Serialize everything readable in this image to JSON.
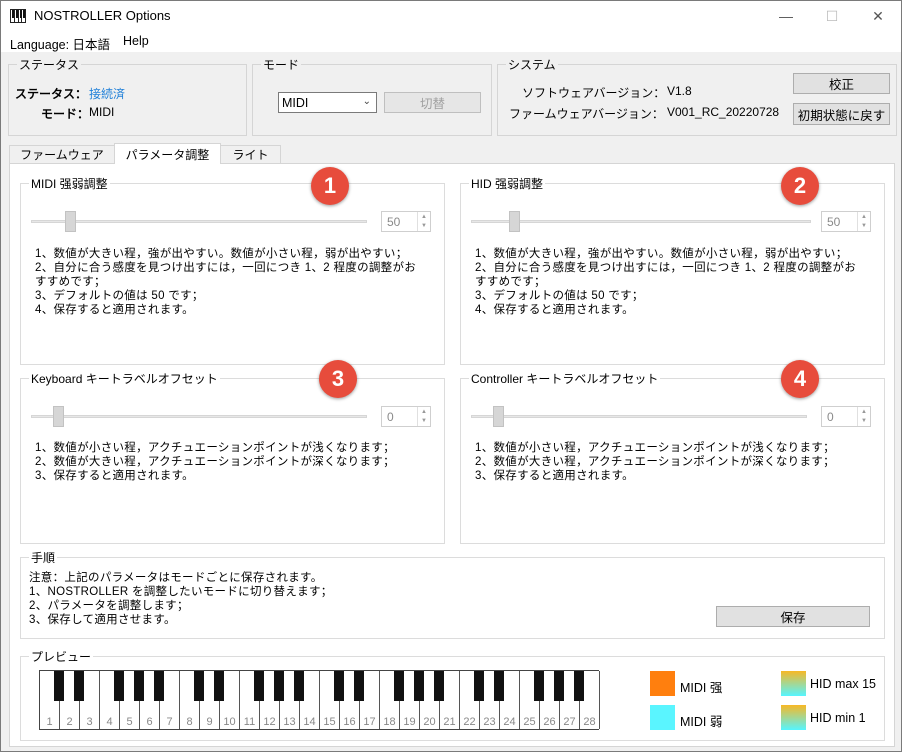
{
  "window": {
    "title": "NOSTROLLER  Options",
    "minimize": "—",
    "maximize": "☐",
    "close": "✕"
  },
  "menu": {
    "language": "Language: 日本語",
    "help": "Help"
  },
  "status": {
    "title": "ステータス",
    "status_label": "ステータス：",
    "status_value": "接続済",
    "status_color": "#1e7fd8",
    "mode_label": "モード：",
    "mode_value": "MIDI"
  },
  "mode": {
    "title": "モード",
    "select_value": "MIDI",
    "switch_label": "切替"
  },
  "system": {
    "title": "システム",
    "software_label": "ソフトウェアバージョン：",
    "software_value": "V1.8",
    "firmware_label": "ファームウェアバージョン：",
    "firmware_value": "V001_RC_20220728",
    "calibrate_label": "校正",
    "reset_label": "初期状態に戻す"
  },
  "tabs": [
    "ファームウェア",
    "パラメータ調整",
    "ライト"
  ],
  "active_tab": "パラメータ調整",
  "panels": [
    {
      "badge": "1",
      "title": "MIDI 强弱調整",
      "value": "50",
      "lines": [
        "1、数値が大きい程，強が出やすい。数値が小さい程，弱が出やすい；",
        "2、自分に合う感度を見つけ出すには，一回につき 1、2 程度の調整がお",
        "すすめです；",
        "3、デフォルトの値は 50 です；",
        "4、保存すると適用されます。"
      ]
    },
    {
      "badge": "2",
      "title": "HID 强弱調整",
      "value": "50",
      "lines": [
        "1、数値が大きい程，強が出やすい。数値が小さい程，弱が出やすい；",
        "2、自分に合う感度を見つけ出すには，一回につき 1、2 程度の調整がお",
        "すすめです；",
        "3、デフォルトの値は 50 です；",
        "4、保存すると適用されます。"
      ]
    },
    {
      "badge": "3",
      "title": "Keyboard キートラベルオフセット",
      "value": "0",
      "lines": [
        "1、数値が小さい程，アクチュエーションポイントが浅くなります；",
        "2、数値が大きい程，アクチュエーションポイントが深くなります；",
        "3、保存すると適用されます。"
      ]
    },
    {
      "badge": "4",
      "title": "Controller キートラベルオフセット",
      "value": "0",
      "lines": [
        "1、数値が小さい程，アクチュエーションポイントが浅くなります；",
        "2、数値が大きい程，アクチュエーションポイントが深くなります；",
        "3、保存すると適用されます。"
      ]
    }
  ],
  "procedure": {
    "title": "手順",
    "lines": [
      "注意：上記のパラメータはモードごとに保存されます。",
      "1、NOSTROLLER を調整したいモードに切り替えます；",
      "2、パラメータを調整します；",
      "3、保存して適用させます。"
    ],
    "save_label": "保存"
  },
  "preview": {
    "title": "プレビュー",
    "keys": [
      "1",
      "2",
      "3",
      "4",
      "5",
      "6",
      "7",
      "8",
      "9",
      "10",
      "11",
      "12",
      "13",
      "14",
      "15",
      "16",
      "17",
      "18",
      "19",
      "20",
      "21",
      "22",
      "23",
      "24",
      "25",
      "26",
      "27",
      "28"
    ],
    "legend": {
      "midi_strong": "MIDI 强",
      "midi_weak": "MIDI 弱",
      "hid_max": "HID max 15",
      "hid_min": "HID min 1"
    },
    "colors": {
      "midi_strong": "#ff7f0e",
      "midi_weak": "#5af5ff",
      "hid_max": "#f7b825",
      "hid_min": "#55f5ff"
    }
  }
}
